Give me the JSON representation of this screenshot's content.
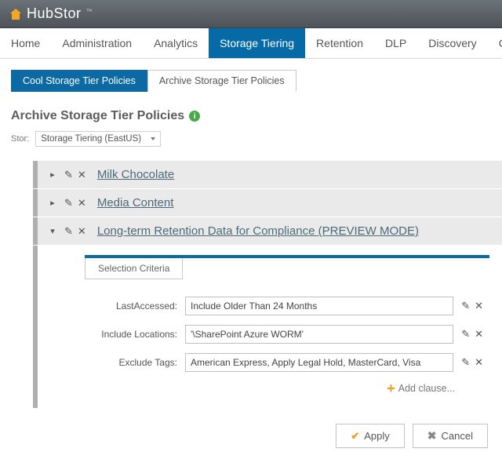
{
  "brand": "HubStor",
  "topnav": [
    "Home",
    "Administration",
    "Analytics",
    "Storage Tiering",
    "Retention",
    "DLP",
    "Discovery",
    "Chargeback",
    "C"
  ],
  "topnav_active": 3,
  "tabs": [
    "Cool Storage Tier Policies",
    "Archive Storage Tier Policies"
  ],
  "tabs_active": 1,
  "page_title": "Archive Storage Tier Policies",
  "stor": {
    "label": "Stor:",
    "value": "Storage Tiering (EastUS)"
  },
  "policies": [
    {
      "name": "Milk Chocolate",
      "expanded": false
    },
    {
      "name": "Media Content",
      "expanded": false
    },
    {
      "name": "Long-term Retention Data for Compliance (PREVIEW MODE)",
      "expanded": true
    }
  ],
  "criteria_tab": "Selection Criteria",
  "criteria": [
    {
      "label": "LastAccessed:",
      "value": "Include Older Than 24 Months"
    },
    {
      "label": "Include Locations:",
      "value": "'\\SharePoint Azure WORM'"
    },
    {
      "label": "Exclude Tags:",
      "value": "American Express, Apply Legal Hold, MasterCard, Visa"
    }
  ],
  "add_clause": "Add clause...",
  "buttons": {
    "apply": "Apply",
    "cancel": "Cancel"
  }
}
